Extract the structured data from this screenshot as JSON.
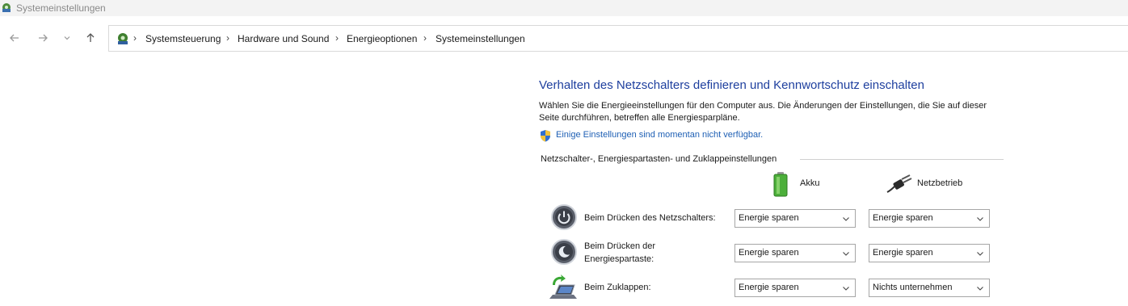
{
  "window": {
    "title": "Systemeinstellungen"
  },
  "breadcrumb": [
    "Systemsteuerung",
    "Hardware und Sound",
    "Energieoptionen",
    "Systemeinstellungen"
  ],
  "breadcrumb_separator": "›",
  "content": {
    "heading": "Verhalten des Netzschalters definieren und Kennwortschutz einschalten",
    "description": "Wählen Sie die Energieeinstellungen für den Computer aus. Die Änderungen der Einstellungen, die Sie auf dieser Seite durchführen, betreffen alle Energiesparpläne.",
    "unavailable_link": "Einige Einstellungen sind momentan nicht verfügbar.",
    "group_label": "Netzschalter-, Energiespartasten- und Zuklappeinstellungen",
    "columns": {
      "battery": "Akku",
      "plugged_in": "Netzbetrieb"
    },
    "rows": [
      {
        "label": "Beim Drücken des Netzschalters:",
        "battery": "Energie sparen",
        "plugged_in": "Energie sparen"
      },
      {
        "label_line1": "Beim Drücken der",
        "label_line2": "Energiespartaste:",
        "battery": "Energie sparen",
        "plugged_in": "Energie sparen"
      },
      {
        "label": "Beim Zuklappen:",
        "battery": "Energie sparen",
        "plugged_in": "Nichts unternehmen"
      }
    ]
  },
  "colors": {
    "heading": "#1e3f9e",
    "link": "#1e5fb4",
    "titlebar": "#f3f3f3"
  },
  "icons": [
    "control-panel-icon",
    "back-arrow-icon",
    "forward-arrow-icon",
    "recent-chevron-icon",
    "up-arrow-icon",
    "uac-shield-icon",
    "battery-icon",
    "power-plug-icon",
    "power-button-icon",
    "sleep-button-icon",
    "laptop-lid-icon",
    "chevron-down-icon"
  ]
}
